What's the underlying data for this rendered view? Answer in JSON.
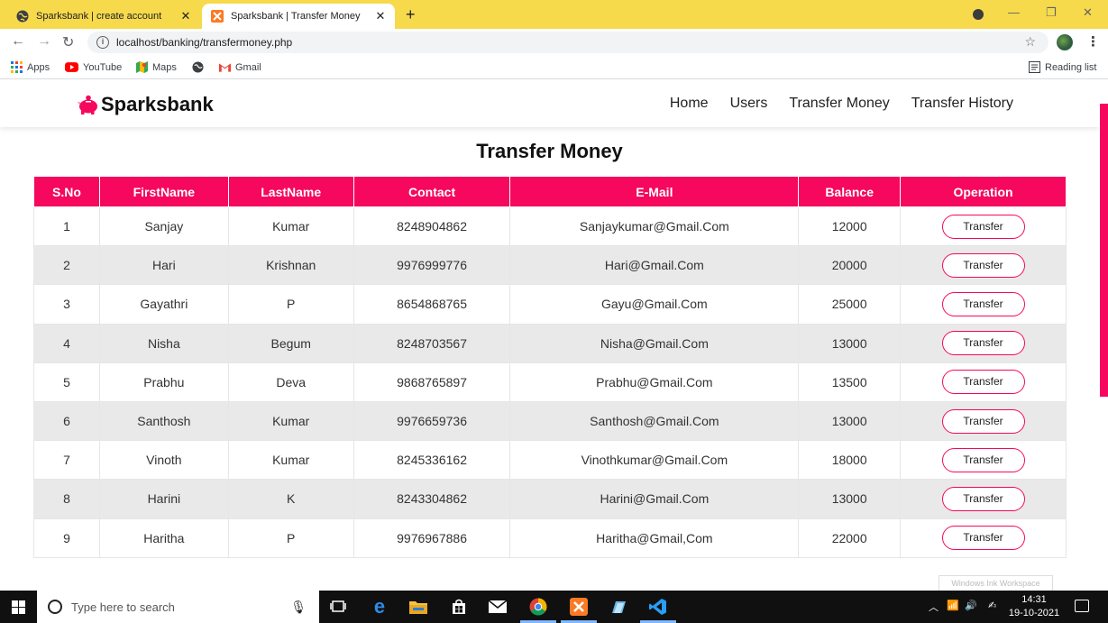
{
  "browser": {
    "tabs": [
      {
        "title": "Sparksbank | create account",
        "active": false,
        "icon": "globe-icon"
      },
      {
        "title": "Sparksbank | Transfer Money",
        "active": true,
        "icon": "xampp-icon"
      }
    ],
    "new_tab_label": "+",
    "url": "localhost/banking/transfermoney.php",
    "bookmarks": [
      {
        "label": "Apps",
        "icon": "apps-grid-icon"
      },
      {
        "label": "YouTube",
        "icon": "youtube-icon"
      },
      {
        "label": "Maps",
        "icon": "maps-icon"
      },
      {
        "label": "",
        "icon": "globe-icon"
      },
      {
        "label": "Gmail",
        "icon": "gmail-icon"
      }
    ],
    "reading_list": "Reading list"
  },
  "site": {
    "brand": "Sparksbank",
    "brand_icon": "piggy-bank-icon",
    "nav": [
      "Home",
      "Users",
      "Transfer Money",
      "Transfer History"
    ],
    "accent_color": "#f5085e"
  },
  "main": {
    "heading": "Transfer Money",
    "columns": [
      "S.No",
      "FirstName",
      "LastName",
      "Contact",
      "E-Mail",
      "Balance",
      "Operation"
    ],
    "rows": [
      {
        "sno": "1",
        "first": "Sanjay",
        "last": "Kumar",
        "contact": "8248904862",
        "email": "Sanjaykumar@Gmail.Com",
        "balance": "12000",
        "action": "Transfer"
      },
      {
        "sno": "2",
        "first": "Hari",
        "last": "Krishnan",
        "contact": "9976999776",
        "email": "Hari@Gmail.Com",
        "balance": "20000",
        "action": "Transfer"
      },
      {
        "sno": "3",
        "first": "Gayathri",
        "last": "P",
        "contact": "8654868765",
        "email": "Gayu@Gmail.Com",
        "balance": "25000",
        "action": "Transfer"
      },
      {
        "sno": "4",
        "first": "Nisha",
        "last": "Begum",
        "contact": "8248703567",
        "email": "Nisha@Gmail.Com",
        "balance": "13000",
        "action": "Transfer"
      },
      {
        "sno": "5",
        "first": "Prabhu",
        "last": "Deva",
        "contact": "9868765897",
        "email": "Prabhu@Gmail.Com",
        "balance": "13500",
        "action": "Transfer"
      },
      {
        "sno": "6",
        "first": "Santhosh",
        "last": "Kumar",
        "contact": "9976659736",
        "email": "Santhosh@Gmail.Com",
        "balance": "13000",
        "action": "Transfer"
      },
      {
        "sno": "7",
        "first": "Vinoth",
        "last": "Kumar",
        "contact": "8245336162",
        "email": "Vinothkumar@Gmail.Com",
        "balance": "18000",
        "action": "Transfer"
      },
      {
        "sno": "8",
        "first": "Harini",
        "last": "K",
        "contact": "8243304862",
        "email": "Harini@Gmail.Com",
        "balance": "13000",
        "action": "Transfer"
      },
      {
        "sno": "9",
        "first": "Haritha",
        "last": "P",
        "contact": "9976967886",
        "email": "Haritha@Gmail,Com",
        "balance": "22000",
        "action": "Transfer"
      }
    ]
  },
  "overlay": {
    "ink_workspace": "Windows Ink Workspace"
  },
  "taskbar": {
    "search_placeholder": "Type here to search",
    "apps": [
      "task-view-icon",
      "edge-icon",
      "file-explorer-icon",
      "store-icon",
      "mail-icon",
      "chrome-icon",
      "xampp-icon",
      "notes-icon",
      "vscode-icon"
    ],
    "time": "14:31",
    "date": "19-10-2021"
  }
}
